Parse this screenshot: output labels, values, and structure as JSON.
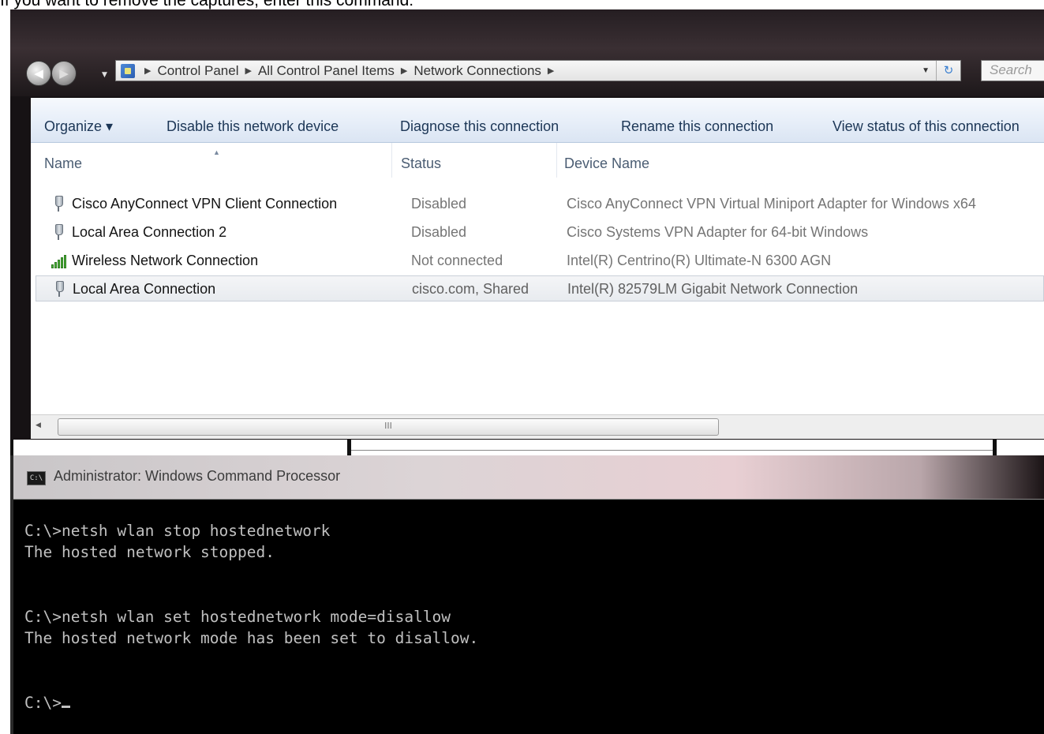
{
  "caption": "If you want to remove the captures, enter this command:",
  "explorer": {
    "breadcrumbs": [
      "Control Panel",
      "All Control Panel Items",
      "Network Connections"
    ],
    "search_placeholder": "Search",
    "toolbar": {
      "organize": "Organize ▾",
      "disable": "Disable this network device",
      "diagnose": "Diagnose this connection",
      "rename": "Rename this connection",
      "view_status": "View status of this connection"
    },
    "columns": {
      "name": "Name",
      "status": "Status",
      "device": "Device Name"
    },
    "rows": [
      {
        "name": "Cisco AnyConnect VPN Client Connection",
        "status": "Disabled",
        "device": "Cisco AnyConnect VPN Virtual Miniport Adapter for Windows x64",
        "icon": "wired-connection-icon"
      },
      {
        "name": "Local Area Connection 2",
        "status": "Disabled",
        "device": "Cisco Systems VPN Adapter for 64-bit Windows",
        "icon": "wired-connection-icon"
      },
      {
        "name": "Wireless Network Connection",
        "status": "Not connected",
        "device": "Intel(R) Centrino(R) Ultimate-N 6300 AGN",
        "icon": "wireless-signal-icon"
      },
      {
        "name": "Local Area Connection",
        "status": "cisco.com, Shared",
        "device": "Intel(R) 82579LM Gigabit Network Connection",
        "icon": "wired-connection-icon"
      }
    ],
    "scroll_grip": "III"
  },
  "cmd": {
    "title": "Administrator: Windows Command Processor",
    "icon_text": "C:\\",
    "lines": [
      "C:\\>netsh wlan stop hostednetwork",
      "The hosted network stopped.",
      "",
      "",
      "C:\\>netsh wlan set hostednetwork mode=disallow",
      "The hosted network mode has been set to disallow.",
      "",
      ""
    ],
    "prompt": "C:\\>"
  }
}
